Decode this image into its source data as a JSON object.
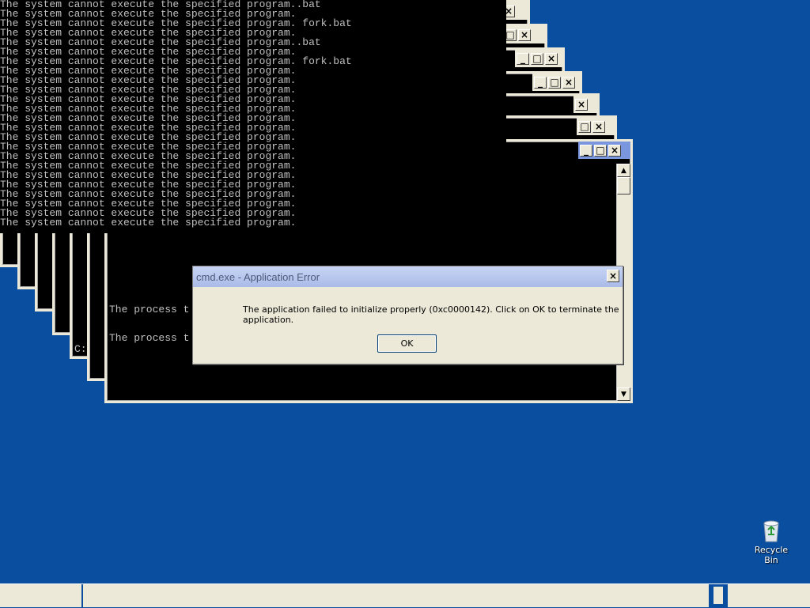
{
  "console": {
    "lines": [
      "The system cannot execute the specified program..bat",
      "The system cannot execute the specified program.",
      "The system cannot execute the specified program. fork.bat",
      "The system cannot execute the specified program.",
      "The system cannot execute the specified program..bat",
      "The system cannot execute the specified program.",
      "The system cannot execute the specified program. fork.bat",
      "The system cannot execute the specified program.",
      "The system cannot execute the specified program.",
      "The system cannot execute the specified program.",
      "The system cannot execute the specified program.",
      "The system cannot execute the specified program.",
      "The system cannot execute the specified program.",
      "The system cannot execute the specified program.",
      "The system cannot execute the specified program.",
      "The system cannot execute the specified program.",
      "The system cannot execute the specified program.",
      "The system cannot execute the specified program.",
      "The system cannot execute the specified program.",
      "The system cannot execute the specified program.",
      "The system cannot execute the specified program.",
      "The system cannot execute the specified program.",
      "The system cannot execute the specified program.",
      "The system cannot execute the specified program."
    ],
    "behind_line_1": "The process t",
    "behind_line_2": "The process t",
    "prompt_fragment": "C:"
  },
  "dialog": {
    "title": "cmd.exe - Application Error",
    "message": "The application failed to initialize properly (0xc0000142). Click on OK to terminate the application.",
    "ok_label": "OK"
  },
  "desktop": {
    "recycle_bin_label": "Recycle Bin"
  },
  "icons": {
    "close": "×",
    "maximize": "□",
    "minimize": "_",
    "scroll_up": "▲",
    "scroll_down": "▼"
  }
}
